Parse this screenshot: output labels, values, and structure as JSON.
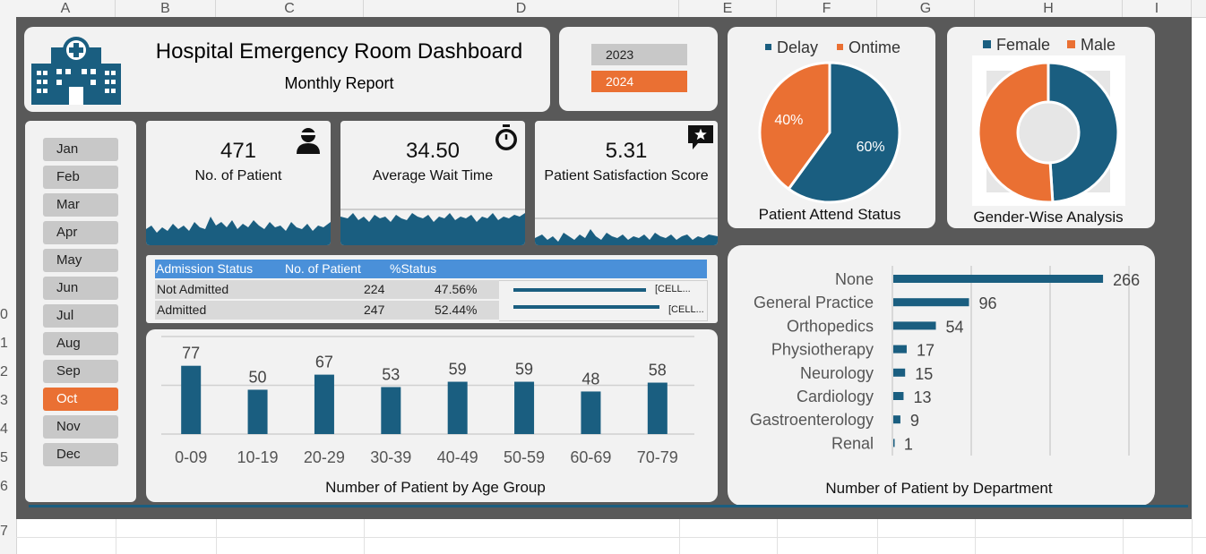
{
  "spreadsheet": {
    "columns": [
      "A",
      "B",
      "C",
      "D",
      "E",
      "F",
      "G",
      "H",
      "I"
    ],
    "rows": [
      "0",
      "1",
      "2",
      "3",
      "4",
      "5",
      "6",
      "7"
    ]
  },
  "header": {
    "title": "Hospital Emergency Room Dashboard",
    "subtitle": "Monthly Report",
    "icon": "hospital-icon"
  },
  "years": [
    "2023",
    "2024"
  ],
  "selected_year": "2024",
  "months": [
    "Jan",
    "Feb",
    "Mar",
    "Apr",
    "May",
    "Jun",
    "Jul",
    "Aug",
    "Sep",
    "Oct",
    "Nov",
    "Dec"
  ],
  "selected_month": "Oct",
  "kpis": [
    {
      "value": "471",
      "label": "No. of Patient",
      "icon": "person-icon"
    },
    {
      "value": "34.50",
      "label": "Average Wait Time",
      "icon": "stopwatch-icon"
    },
    {
      "value": "5.31",
      "label": "Patient Satisfaction Score",
      "icon": "star-chat-icon"
    }
  ],
  "admission_table": {
    "headers": [
      "Admission Status",
      "No. of Patient",
      "%Status"
    ],
    "rows": [
      {
        "status": "Not Admitted",
        "count": "224",
        "pct": "47.56%",
        "bar_fraction": 0.4756,
        "bar_label": "[CELL..."
      },
      {
        "status": "Admitted",
        "count": "247",
        "pct": "52.44%",
        "bar_fraction": 0.5244,
        "bar_label": "[CELL..."
      }
    ]
  },
  "colors": {
    "primary": "#1a5e80",
    "accent": "#ea7033",
    "table_header": "#4a90d9",
    "card_bg": "#f2f2f2",
    "dash_bg": "#595959"
  },
  "chart_data": [
    {
      "type": "pie",
      "title": "Patient Attend Status",
      "categories": [
        "Delay",
        "Ontime"
      ],
      "values": [
        60,
        40
      ],
      "labels": [
        "60%",
        "40%"
      ],
      "colors": [
        "#1a5e80",
        "#ea7033"
      ],
      "legend": "top"
    },
    {
      "type": "pie",
      "donut": true,
      "title": "Gender-Wise Analysis",
      "categories": [
        "Female",
        "Male"
      ],
      "values": [
        49,
        51
      ],
      "colors": [
        "#1a5e80",
        "#ea7033"
      ],
      "legend": "top"
    },
    {
      "type": "bar",
      "title": "Number of Patient by Age Group",
      "categories": [
        "0-09",
        "10-19",
        "20-29",
        "30-39",
        "40-49",
        "50-59",
        "60-69",
        "70-79"
      ],
      "values": [
        77,
        50,
        67,
        53,
        59,
        59,
        48,
        58
      ],
      "ylim": [
        0,
        110
      ],
      "grid": true
    },
    {
      "type": "bar",
      "orientation": "horizontal",
      "title": "Number of Patient by Department",
      "categories": [
        "None",
        "General Practice",
        "Orthopedics",
        "Physiotherapy",
        "Neurology",
        "Cardiology",
        "Gastroenterology",
        "Renal"
      ],
      "values": [
        266,
        96,
        54,
        17,
        15,
        13,
        9,
        1
      ],
      "xlim": [
        0,
        300
      ],
      "grid": true
    }
  ]
}
